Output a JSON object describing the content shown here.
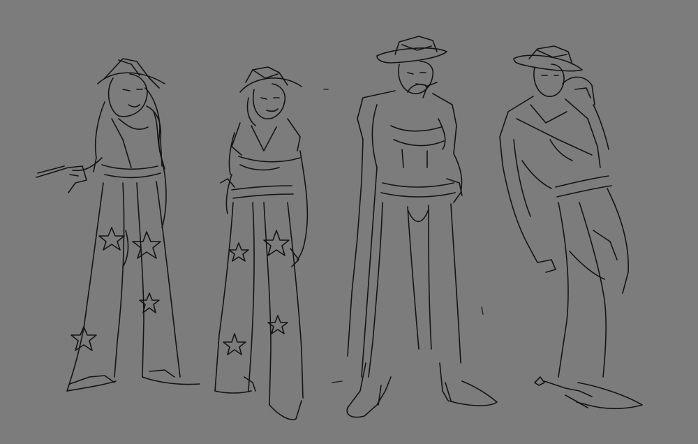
{
  "image": {
    "subject": "four-figure-sketch-lineup",
    "background_color": "#7c7c7c",
    "line_color": "#141414"
  },
  "figures": [
    {
      "id": "figure-1",
      "pose": "standing-holding-revolver"
    },
    {
      "id": "figure-2",
      "pose": "standing-hand-on-hip"
    },
    {
      "id": "figure-3",
      "pose": "standing-smoking"
    },
    {
      "id": "figure-4",
      "pose": "leaning-tipping-hat"
    }
  ]
}
